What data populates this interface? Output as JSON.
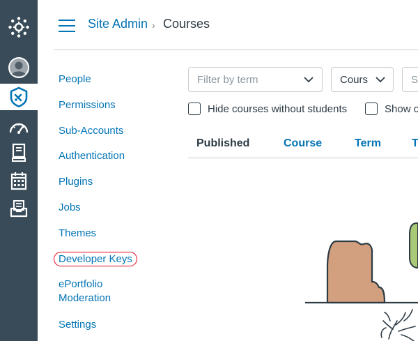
{
  "breadcrumb": {
    "root": "Site Admin",
    "separator": "›",
    "current": "Courses"
  },
  "section_nav": [
    "People",
    "Permissions",
    "Sub-Accounts",
    "Authentication",
    "Plugins",
    "Jobs",
    "Themes",
    "Developer Keys",
    "ePortfolio Moderation",
    "Settings"
  ],
  "filters": {
    "term_placeholder": "Filter by term",
    "course_type_value": "Cours",
    "search_partial": "Se",
    "hide_without_students_label": "Hide courses without students",
    "show_other_label": "Show o"
  },
  "table": {
    "headers": [
      "Published",
      "Course",
      "Term",
      "Te"
    ]
  },
  "icons": {
    "global_nav": [
      "canvas-logo-icon",
      "account-avatar-icon",
      "admin-shield-icon",
      "dashboard-icon",
      "courses-icon",
      "calendar-icon",
      "inbox-icon"
    ]
  },
  "colors": {
    "nav_bg": "#394b58",
    "link": "#0374b5",
    "text": "#2d3b45",
    "highlight_circle": "#e0061f"
  }
}
